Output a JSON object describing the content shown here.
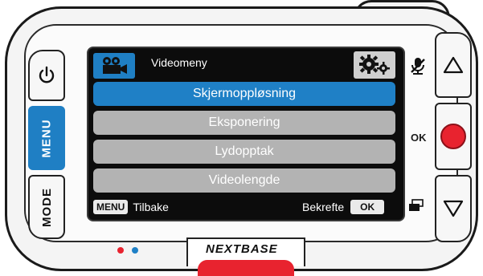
{
  "buttons": {
    "power_icon": "power-icon",
    "menu_label": "MENU",
    "mode_label": "MODE",
    "up_icon": "triangle-up-icon",
    "ok_icon": "record-circle-icon",
    "down_icon": "triangle-down-icon"
  },
  "screen": {
    "header": {
      "title": "Videomeny",
      "left_icon": "video-camera-icon",
      "right_icon": "settings-gears-icon"
    },
    "menu_items": [
      {
        "label": "Skjermoppløsning",
        "selected": true
      },
      {
        "label": "Eksponering",
        "selected": false
      },
      {
        "label": "Lydopptak",
        "selected": false
      },
      {
        "label": "Videolengde",
        "selected": false
      }
    ],
    "footer": {
      "back_key": "MENU",
      "back_label": "Tilbake",
      "confirm_label": "Bekrefte",
      "confirm_key": "OK"
    }
  },
  "side_labels": {
    "mic_icon": "microphone-muted-icon",
    "ok_label": "OK",
    "display_icon": "display-toggle-icon"
  },
  "brand": {
    "name": "NEXTBASE"
  },
  "colors": {
    "accent_blue": "#1f80c6",
    "record_red": "#e8232f",
    "led_red": "#e8232f",
    "led_blue": "#1f80c6"
  }
}
